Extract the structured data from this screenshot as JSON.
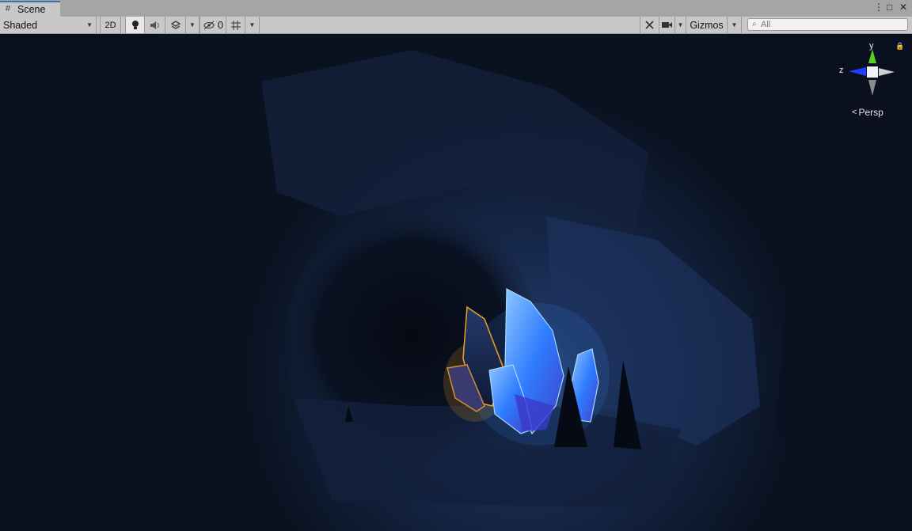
{
  "tab": {
    "title": "Scene",
    "glyph": "#"
  },
  "window_controls": {
    "menu": "⋮",
    "maximize": "□",
    "close": "✕"
  },
  "toolbar": {
    "draw_mode": "Shaded",
    "mode_2d": "2D",
    "hidden_count": "0",
    "gizmos": "Gizmos"
  },
  "search": {
    "placeholder": "All"
  },
  "gizmo": {
    "y_axis": "y",
    "z_axis": "z",
    "projection": "Persp"
  },
  "colors": {
    "accent": "#3a72b0",
    "crystal_blue": "#3c8cff",
    "crystal_gold": "#f0a020",
    "cave": "#0c1424"
  }
}
